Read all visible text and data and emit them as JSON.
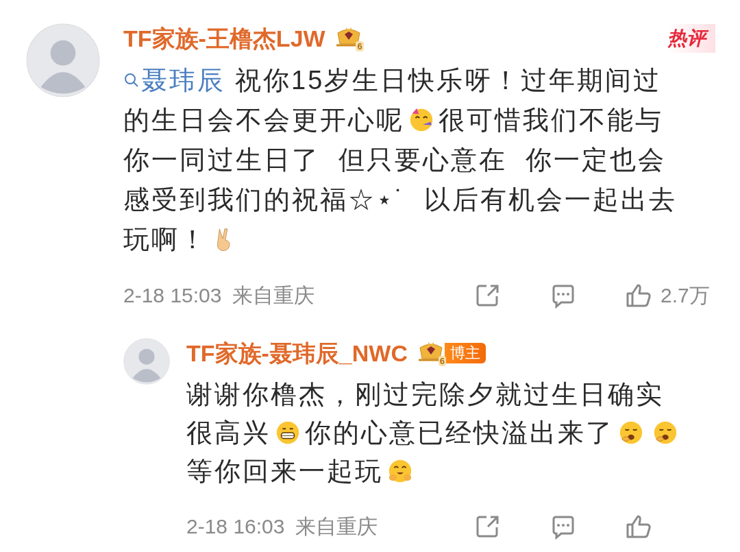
{
  "comment": {
    "author": "TF家族-王橹杰LJW",
    "badge": {
      "level": "6"
    },
    "tag": "热评",
    "lines": [
      [
        {
          "kind": "mention",
          "text": "聂玮辰"
        },
        {
          "kind": "text",
          "text": "祝你15岁生日快乐呀！过年期间过"
        }
      ],
      [
        {
          "kind": "text",
          "text": "的生日会不会更开心呢"
        },
        {
          "kind": "party"
        },
        {
          "kind": "text",
          "text": "很可惜我们不能与"
        }
      ],
      [
        {
          "kind": "text",
          "text": "你一同过生日了  但只要心意在  你一定也会"
        }
      ],
      [
        {
          "kind": "text",
          "text": "感受到我们的祝福☆⋆˙  以后有机会一起出去"
        }
      ],
      [
        {
          "kind": "text",
          "text": "玩啊！"
        },
        {
          "kind": "victory"
        }
      ]
    ],
    "time": "2-18 15:03",
    "location": "来自重庆",
    "likes": "2.7万"
  },
  "reply": {
    "author": "TF家族-聂玮辰_NWC",
    "badge": {
      "level": "6",
      "label": "博主"
    },
    "lines": [
      [
        {
          "kind": "text",
          "text": "谢谢你橹杰，刚过完除夕就过生日确实"
        }
      ],
      [
        {
          "kind": "text",
          "text": "很高兴"
        },
        {
          "kind": "grin"
        },
        {
          "kind": "text",
          "text": "你的心意已经快溢出来了"
        },
        {
          "kind": "yawn"
        },
        {
          "kind": "yawn"
        }
      ],
      [
        {
          "kind": "text",
          "text": "等你回来一起玩"
        },
        {
          "kind": "blush"
        }
      ]
    ],
    "time": "2-18 16:03",
    "location": "来自重庆"
  }
}
